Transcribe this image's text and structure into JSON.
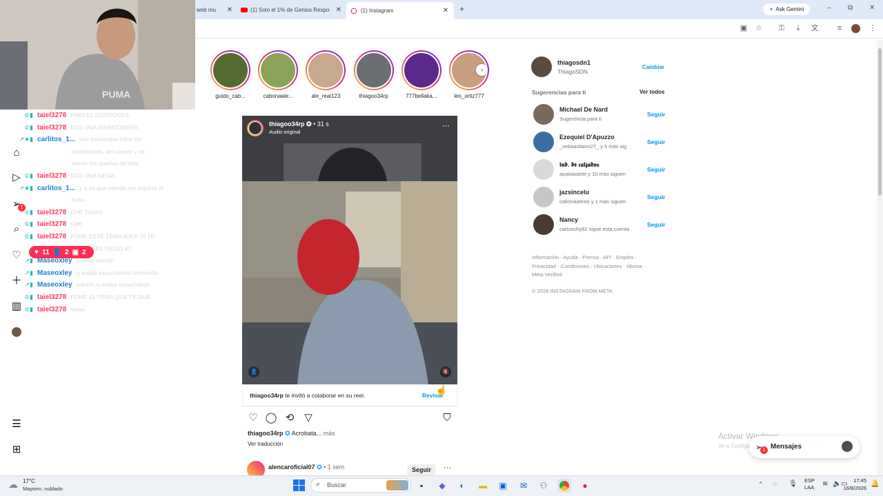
{
  "browser": {
    "tabs": [
      {
        "title": "web mu",
        "active": false
      },
      {
        "title": "(1) Solo el 1% de Genios Respo",
        "active": false
      },
      {
        "title": "(1) Instagram",
        "active": true
      }
    ],
    "new_tab": "+",
    "ask_gemini": "Ask Gemini",
    "window_controls": {
      "minimize": "–",
      "restore": "⧉",
      "close": "✕"
    }
  },
  "chat": [
    {
      "user": "taiel3278",
      "msg": "PINO EL CORDORES",
      "color": "#ff3b5c",
      "badges": "♔▮"
    },
    {
      "user": "taiel3278",
      "msg": "SOS UNA MARICONERA",
      "color": "#ff3b5c",
      "badges": "♔▮"
    },
    {
      "user": "carlitos_1...",
      "msg": "son tremendos Kilos los",
      "color": "#1e7fd6",
      "badges": "↗★▮"
    },
    {
      "user": "",
      "msg": "cocilaheces, ahi vienen y se",
      "color": "#1e7fd6",
      "badges": ""
    },
    {
      "user": "",
      "msg": "hacen los dueños de todo",
      "color": "#1e7fd6",
      "badges": ""
    },
    {
      "user": "taiel3278",
      "msg": "SOS UNA NENA",
      "color": "#ff3b5c",
      "badges": "♔▮"
    },
    {
      "user": "carlitos_1...",
      "msg": "y a mi que mierda me importa el",
      "color": "#1e7fd6",
      "badges": "↗★▮"
    },
    {
      "user": "",
      "msg": "bebo",
      "color": "#1e7fd6",
      "badges": ""
    },
    {
      "user": "taiel3278",
      "msg": "CHE TIAGO",
      "color": "#ff3b5c",
      "badges": "♔▮"
    },
    {
      "user": "taiel3278",
      "msg": "CHE",
      "color": "#ff3b5c",
      "badges": "♔▮"
    },
    {
      "user": "taiel3278",
      "msg": "PONE ESTE TEMA AVER SI TE",
      "color": "#ff3b5c",
      "badges": "♔▮"
    },
    {
      "user": "",
      "msg": "GUSTA MIS PIESO 47",
      "color": "#ff3b5c",
      "badges": ""
    },
    {
      "user": "Maseoxley",
      "msg": "q onda wachin",
      "color": "#1e7fd6",
      "badges": "↗▮"
    },
    {
      "user": "Maseoxley",
      "msg": "q andas escuchando hermanito",
      "color": "#1e7fd6",
      "badges": "↗▮"
    },
    {
      "user": "Maseoxley",
      "msg": "wachin q andas escuchando",
      "color": "#1e7fd6",
      "badges": "↗▮"
    },
    {
      "user": "taiel3278",
      "msg": "PONE EL TEMA QUE TE DIJE",
      "color": "#ff3b5c",
      "badges": "♔▮"
    },
    {
      "user": "taiel3278",
      "msg": "dalee",
      "color": "#ff3b5c",
      "badges": "♔▮"
    }
  ],
  "stream_stats": {
    "likes": "11",
    "viewers": "2",
    "third": "2"
  },
  "nav": {
    "notifications_badge": "1"
  },
  "stories": [
    {
      "name": "guido_cab..."
    },
    {
      "name": "cabonaale..."
    },
    {
      "name": "ale_real123"
    },
    {
      "name": "thiagoo34rp"
    },
    {
      "name": "777bellaka..."
    },
    {
      "name": "leo_ortiz777"
    }
  ],
  "post": {
    "author": "thiagoo34rp",
    "time": "• 31 s",
    "audio": "Audio original",
    "collab_user": "thiagoo34rp",
    "collab_text": "te invitó a colaborar en su reel.",
    "review": "Revisar",
    "caption_user": "thiagoo34rp",
    "caption": "Acrobata...",
    "more": "más",
    "translate": "Ver traducción",
    "next_author": "alencaroficial07",
    "next_time": "• 1 sem",
    "next_follow": "Seguir",
    "options": "···"
  },
  "account": {
    "username": "thiagosdn1",
    "name": "ThiagoSDN",
    "switch": "Cambiar"
  },
  "suggestions_header": {
    "title": "Sugerencias para ti",
    "see_all": "Ver todos"
  },
  "suggestions": [
    {
      "name": "Michael De Nard",
      "sub": "Sugerencia para ti",
      "action": "Seguir"
    },
    {
      "name": "Ezequiel D'Apuzzo",
      "sub": "_sebaastiann27_ y 5 más sig",
      "action": "Seguir"
    },
    {
      "name": "𝖎𝖓𝖉. 𝖉𝖊 𝖈𝖆𝖑𝖟𝖆𝖉𝖔𝖘",
      "sub": "apaixaoarte y 10 más siguen",
      "action": "Seguir"
    },
    {
      "name": "jazsincelu",
      "sub": "cabonaalexis y 1 más siguen",
      "action": "Seguir"
    },
    {
      "name": "Nancy",
      "sub": "carlonchy82 sigue esta cuenta",
      "action": "Seguir"
    }
  ],
  "footer": {
    "line1": "Información · Ayuda · Prensa · API · Empleo ·",
    "line2": "Privacidad · Condiciones · Ubicaciones · Idioma ·",
    "line3": "Meta Verified",
    "copyright": "© 2026 INSTAGRAM FROM META"
  },
  "activate_windows": "Activar Windows",
  "activate_sub": "Ve a Configuración para activar Windows.",
  "messages": {
    "label": "Mensajes",
    "badge": "1"
  },
  "taskbar": {
    "weather_temp": "17°C",
    "weather_desc": "Mayorm. nublado",
    "search_placeholder": "Buscar",
    "lang": "ESP",
    "lang2": "LAA",
    "time": "17:45",
    "date": "16/8/2026"
  },
  "colors": {
    "accent": "#0095f6",
    "chat_red": "#ff3b5c",
    "chat_blue": "#1e7fd6"
  }
}
